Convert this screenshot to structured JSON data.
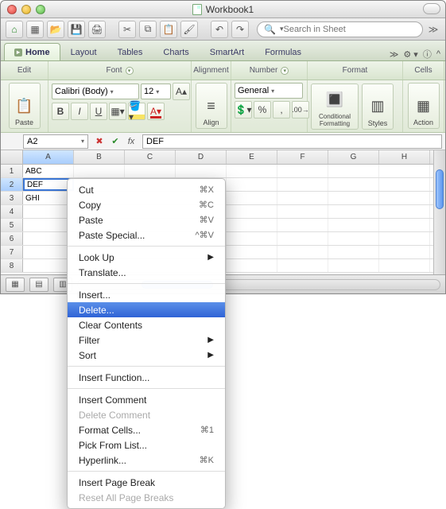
{
  "window": {
    "title": "Workbook1"
  },
  "search": {
    "placeholder": "Search in Sheet"
  },
  "ribbon_tabs": {
    "home": "Home",
    "layout": "Layout",
    "tables": "Tables",
    "charts": "Charts",
    "smartart": "SmartArt",
    "formulas": "Formulas"
  },
  "ribbon_groups": {
    "edit": "Edit",
    "font": "Font",
    "alignment": "Alignment",
    "number": "Number",
    "format": "Format",
    "cells": "Cells"
  },
  "ribbon_controls": {
    "paste": "Paste",
    "font_name": "Calibri (Body)",
    "font_size": "12",
    "bold": "B",
    "italic": "I",
    "underline": "U",
    "align": "Align",
    "number_format": "General",
    "cond_fmt": "Conditional Formatting",
    "styles": "Styles",
    "action": "Action"
  },
  "formula_bar": {
    "name_box": "A2",
    "fx": "fx",
    "value": "DEF"
  },
  "columns": [
    "A",
    "B",
    "C",
    "D",
    "E",
    "F",
    "G",
    "H"
  ],
  "rows": [
    {
      "num": "1",
      "a": "ABC"
    },
    {
      "num": "2",
      "a": "DEF"
    },
    {
      "num": "3",
      "a": "GHI"
    },
    {
      "num": "4",
      "a": ""
    },
    {
      "num": "5",
      "a": ""
    },
    {
      "num": "6",
      "a": ""
    },
    {
      "num": "7",
      "a": ""
    },
    {
      "num": "8",
      "a": ""
    }
  ],
  "context_menu": {
    "cut": {
      "label": "Cut",
      "shortcut": "⌘X"
    },
    "copy": {
      "label": "Copy",
      "shortcut": "⌘C"
    },
    "paste": {
      "label": "Paste",
      "shortcut": "⌘V"
    },
    "paste_special": {
      "label": "Paste Special...",
      "shortcut": "^⌘V"
    },
    "look_up": {
      "label": "Look Up",
      "submenu": true
    },
    "translate": {
      "label": "Translate..."
    },
    "insert": {
      "label": "Insert..."
    },
    "delete": {
      "label": "Delete..."
    },
    "clear": {
      "label": "Clear Contents"
    },
    "filter": {
      "label": "Filter",
      "submenu": true
    },
    "sort": {
      "label": "Sort",
      "submenu": true
    },
    "insert_fn": {
      "label": "Insert Function..."
    },
    "insert_comment": {
      "label": "Insert Comment"
    },
    "delete_comment": {
      "label": "Delete Comment"
    },
    "format_cells": {
      "label": "Format Cells...",
      "shortcut": "⌘1"
    },
    "pick_from_list": {
      "label": "Pick From List..."
    },
    "hyperlink": {
      "label": "Hyperlink...",
      "shortcut": "⌘K"
    },
    "insert_pb": {
      "label": "Insert Page Break"
    },
    "reset_pb": {
      "label": "Reset All Page Breaks"
    }
  }
}
